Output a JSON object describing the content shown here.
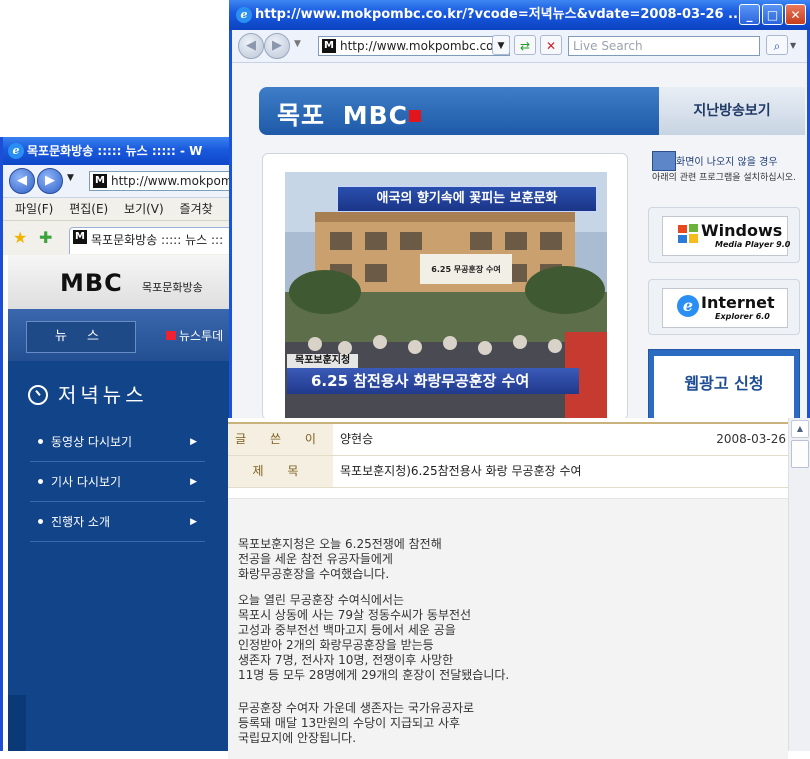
{
  "back_window": {
    "title": "목포문화방송 ::::: 뉴스 ::::: - W",
    "url": "http://www.mokpom",
    "menu": [
      "파일(F)",
      "편집(E)",
      "보기(V)",
      "즐겨찾"
    ],
    "tab_label": "목포문화방송 ::::: 뉴스 :::",
    "site": {
      "logo": "MBC",
      "logo_sub": "목포문화방송",
      "nav_news": "뉴 스",
      "nav_news_today": "뉴스투데",
      "section_title": "저녁뉴스",
      "sidebar_items": [
        "동영상 다시보기",
        "기사 다시보기",
        "진행자 소개"
      ]
    }
  },
  "front_window": {
    "title": "http://www.mokpombc.co.kr/?vcode=저녁뉴스&vdate=2008-03-26 ...",
    "url": "http://www.mokpombc.co",
    "search_placeholder": "Live Search",
    "site": {
      "header_logo_left": "목포",
      "header_logo_right": "MBC",
      "header_right": "지난방송보기",
      "video": {
        "banner": "애국의 향기속에 꽃피는 보훈문화",
        "sign": "6.25 무공훈장 수여",
        "caption_sub": "목포보훈지청",
        "caption_main": "6.25 참전용사 화랑무공훈장 수여"
      },
      "help_line1": "화면이 나오지 않을 경우",
      "help_line2": "아래의 관련 프로그램을 설치하십시오.",
      "downloads": [
        {
          "name": "Windows",
          "version": "Media Player 9.0"
        },
        {
          "name": "Internet",
          "version": "Explorer 6.0"
        }
      ],
      "ad_label": "웹광고 신청"
    }
  },
  "article": {
    "author_label": "글 쓴 이",
    "author": "양현승",
    "date": "2008-03-26",
    "subject_label": "제 목",
    "subject": "목포보훈지청)6.25참전용사 화랑 무공훈장 수여",
    "paragraphs": [
      "목포보훈지청은 오늘 6.25전쟁에 참전해\n전공을 세운 참전 유공자들에게\n화랑무공훈장을 수여했습니다.",
      "오늘 열린 무공훈장 수여식에서는\n목포시 상동에 사는 79살 정동수씨가 동부전선\n고성과 중부전선 백마고지 등에서 세운 공을\n인정받아 2개의 화랑무공훈장을 받는등\n생존자 7명, 전사자 10명, 전쟁이후 사망한\n11명 등 모두 28명에게 29개의 훈장이 전달됐습니다.",
      "무공훈장 수여자 가운데 생존자는 국가유공자로\n등록돼 매달 13만원의 수당이 지급되고 사후\n국립묘지에 안장됩니다."
    ]
  }
}
